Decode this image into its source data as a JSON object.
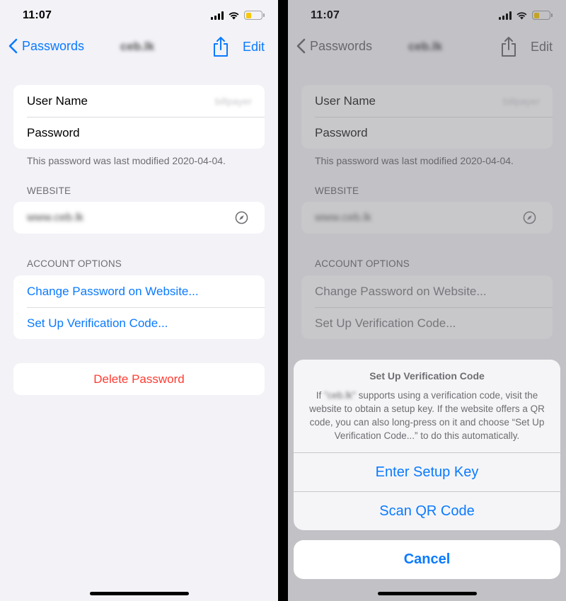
{
  "status": {
    "time": "11:07"
  },
  "nav": {
    "back_label": "Passwords",
    "title": "ceb.lk",
    "edit_label": "Edit"
  },
  "credentials": {
    "username_label": "User Name",
    "username_value": "billpayer",
    "password_label": "Password",
    "footnote": "This password was last modified 2020-04-04."
  },
  "website": {
    "header": "WEBSITE",
    "url": "www.ceb.lk"
  },
  "account_options": {
    "header": "ACCOUNT OPTIONS",
    "change_password": "Change Password on Website...",
    "setup_verification": "Set Up Verification Code..."
  },
  "delete_label": "Delete Password",
  "sheet": {
    "title": "Set Up Verification Code",
    "message_pre": "If",
    "message_site": "\"ceb.lk\"",
    "message_post": "supports using a verification code, visit the website to obtain a setup key. If the website offers a QR code, you can also long-press on it and choose “Set Up Verification Code...” to do this automatically.",
    "actions": [
      "Enter Setup Key",
      "Scan QR Code"
    ],
    "cancel": "Cancel"
  },
  "colors": {
    "accent": "#0a7aff",
    "destructive": "#ff3b30",
    "battery": "#f7c80a"
  },
  "icons": [
    "chevron-left-icon",
    "share-icon",
    "compass-icon",
    "wifi-icon",
    "signal-icon",
    "battery-icon"
  ]
}
